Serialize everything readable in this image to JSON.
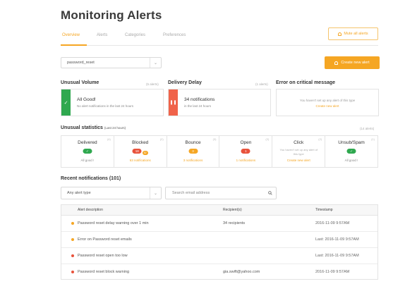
{
  "header": {
    "title": "Monitoring Alerts"
  },
  "tabs": [
    "Overview",
    "Alerts",
    "Categories",
    "Preferences"
  ],
  "actions": {
    "mute_label": "Mute all alerts",
    "create_label": "Create new alert"
  },
  "filter": {
    "selected": "password_reset"
  },
  "sections": {
    "unusual_volume": {
      "label": "Unusual Volume",
      "count": "(5 alerts)",
      "title": "All Good!",
      "sub": "No alert notifications in the last 24 hours",
      "bar_color": "#2fa84f"
    },
    "delivery_delay": {
      "label": "Delivery Delay",
      "count": "(1 alerts)",
      "title": "34 notifications",
      "sub": "in the last 24 hours",
      "bar_color": "#f0634a"
    },
    "critical": {
      "label": "Error on critical message",
      "text": "You haven't set up any alert of this type",
      "link": "Create new alert"
    }
  },
  "stats": {
    "label": "Unusual statistics",
    "sub": "(Last 24 hours)",
    "count": "(14 alerts)",
    "items": [
      {
        "name": "Delivered",
        "idx": "(4)",
        "foot": "All good !"
      },
      {
        "name": "Blocked",
        "idx": "(2)",
        "pill": "18",
        "pill2": "52",
        "foot": "63 notifications"
      },
      {
        "name": "Bounce",
        "idx": "(3)",
        "pill": "3",
        "foot": "3 notifications"
      },
      {
        "name": "Open",
        "idx": "(2)",
        "pill": "1",
        "foot": "1 notifications"
      },
      {
        "name": "Click",
        "idx": "(2)",
        "desc": "You haven't set up any alert of this type",
        "foot": "Create new alert"
      },
      {
        "name": "Unsub/Spam",
        "idx": "(1)",
        "foot": "All good !"
      }
    ]
  },
  "recent": {
    "label": "Recent notifications (101)",
    "type_placeholder": "Any alert type",
    "search_placeholder": "Search email address",
    "columns": [
      "Alert description",
      "Recipient(s)",
      "Timestamp"
    ],
    "rows": [
      {
        "desc": "Password reset delay warning over 1 min",
        "rec": "34 recipients",
        "ts": "2016-11-09 9:57AM",
        "color": "#f5a623"
      },
      {
        "desc": "Error on Password reset emails",
        "rec": "",
        "ts": "Last: 2016-11-09 9:57AM",
        "color": "#f5a623"
      },
      {
        "desc": "Password reset open too low",
        "rec": "",
        "ts": "Last: 2016-11-09 9:57AM",
        "color": "#e8523b"
      },
      {
        "desc": "Password reset block warning",
        "rec": "gia.swift@yahoo.com",
        "ts": "2016-11-09 9:57AM",
        "color": "#e8523b"
      }
    ]
  },
  "colors": {
    "accent": "#f5a623",
    "success": "#2fa84f",
    "danger": "#f0634a"
  }
}
